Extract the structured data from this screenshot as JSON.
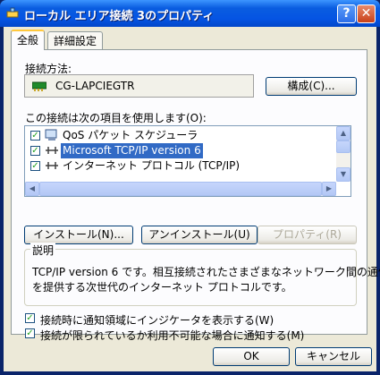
{
  "window": {
    "title": "ローカル エリア接続 3のプロパティ",
    "help_label": "?",
    "close_label": "✕"
  },
  "tabs": [
    {
      "label": "全般"
    },
    {
      "label": "詳細設定"
    }
  ],
  "connect_using": {
    "label": "接続方法:",
    "adapter_name": "CG-LAPCIEGTR",
    "configure_label": "構成(C)..."
  },
  "components": {
    "label": "この接続は次の項目を使用します(O):",
    "items": [
      {
        "label": "QoS パケット スケジューラ",
        "checked": true
      },
      {
        "label": "Microsoft TCP/IP version 6",
        "checked": true,
        "selected": true
      },
      {
        "label": "インターネット プロトコル (TCP/IP)",
        "checked": true
      }
    ]
  },
  "buttons": {
    "install": "インストール(N)...",
    "uninstall": "アンインストール(U)",
    "properties": "プロパティ(R)"
  },
  "description": {
    "title": "説明",
    "text_line1": "TCP/IP version 6 です。相互接続されたさまざまなネットワーク間の通信",
    "text_line2": "を提供する次世代のインターネット プロトコルです。"
  },
  "options": {
    "show_icon": "接続時に通知領域にインジケータを表示する(W)",
    "notify_limited": "接続が限られているか利用不可能な場合に通知する(M)"
  },
  "footer": {
    "ok": "OK",
    "cancel": "キャンセル"
  },
  "colors": {
    "titlebar": "#0554e3",
    "selection": "#316ac5",
    "face": "#ece9d8"
  }
}
